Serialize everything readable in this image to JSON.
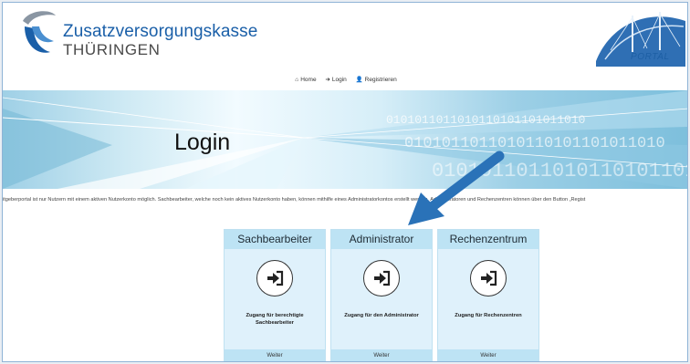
{
  "brand": {
    "line1": "Zusatzversorgungskasse",
    "line2": "THÜRINGEN",
    "portal_label": "PORTAL"
  },
  "nav": [
    {
      "label": "Home",
      "icon": "home-icon"
    },
    {
      "label": "Login",
      "icon": "login-icon"
    },
    {
      "label": "Registrieren",
      "icon": "user-plus-icon"
    }
  ],
  "hero": {
    "title": "Login",
    "binary_text": "0101011011010110101101011010"
  },
  "info_text": "itgeberportal ist nur Nutzern mit einem aktiven Nutzerkonto möglich. Sachbearbeiter, welche noch kein aktives Nutzerkonto haben, können mithilfe eines Administratorkontos erstellt werden. Administratoren und Rechenzentren können über den Button „Regist",
  "cards": [
    {
      "title": "Sachbearbeiter",
      "description": "Zugang für berechtigte Sachbearbeiter",
      "button": "Weiter"
    },
    {
      "title": "Administrator",
      "description": "Zugang für den Administrator",
      "button": "Weiter"
    },
    {
      "title": "Rechenzentrum",
      "description": "Zugang für Rechenzentren",
      "button": "Weiter"
    }
  ],
  "colors": {
    "brand_blue": "#1a5fa8",
    "card_bg": "#dff1fb",
    "card_head": "#bde3f4",
    "arrow": "#2a72b8"
  }
}
